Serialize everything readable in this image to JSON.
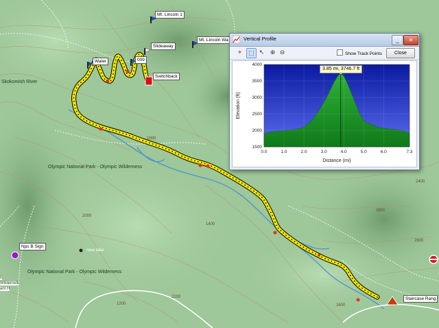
{
  "map": {
    "waypoints": [
      {
        "id": "wp-mt-lincoln-1",
        "label": "Mt. Lincoln 1",
        "icon": "flag-icon"
      },
      {
        "id": "wp-slideaway",
        "label": "Slideaway",
        "icon": "flag-icon"
      },
      {
        "id": "wp-mt-lincoln-wa",
        "label": "Mt. Lincoln Wa",
        "icon": "flag-icon"
      },
      {
        "id": "wp-water",
        "label": "Water",
        "icon": "flag-icon"
      },
      {
        "id": "wp-009",
        "label": "009",
        "icon": "flag-icon"
      },
      {
        "id": "wp-switchback",
        "label": "Switchback",
        "icon": "flag-icon"
      },
      {
        "id": "wp-nps-b-sign",
        "label": "Nps B Sign",
        "icon": "circle-marker-icon"
      },
      {
        "id": "wp-new-lake",
        "label": "new lake",
        "icon": "circle-marker-icon"
      },
      {
        "id": "wp-staircase-rang",
        "label": "Staircase Rang",
        "icon": "campground-icon"
      }
    ],
    "place_labels": {
      "skokomish_river_nw": "Skokomish River",
      "olympic_wilderness_1": "Olympic National Park - Olympic Wilderness",
      "olympic_wilderness_2": "Olympic National Park - Olympic Wilderness",
      "left_edge_a": "lt",
      "left_edge_b": "Wilderne$",
      "left_edge_c": "ant H"
    },
    "elevation_labels": [
      "1800",
      "2000",
      "2400",
      "2800",
      "2600",
      "2200",
      "1600",
      "1200",
      "1400"
    ],
    "colors": {
      "track": "#f2e600",
      "track_outline": "#000000",
      "terrain": "#9ec79a",
      "river": "#4a8fd0"
    }
  },
  "dialog": {
    "title": "Vertical Profile",
    "show_track_points_label": "Show Track Points",
    "close_label": "Close",
    "tooltip": "3.85 mi, 3746.7 ft",
    "toolbar_icons": [
      "crosshair-icon",
      "select-icon",
      "pointer-icon",
      "zoom-in-icon",
      "zoom-out-icon"
    ]
  },
  "chart_data": {
    "type": "area",
    "title": "",
    "xlabel": "Distance (mi)",
    "ylabel": "Elevation (ft)",
    "xlim": [
      0.0,
      7.3
    ],
    "ylim": [
      1500,
      4000
    ],
    "x_ticks": [
      "0.0",
      "1.0",
      "2.0",
      "3.0",
      "4.0",
      "5.0",
      "6.0",
      "7.3"
    ],
    "y_ticks": [
      "1500",
      "2000",
      "2500",
      "3000",
      "3500",
      "4000"
    ],
    "grid": true,
    "colors": {
      "sky_top": "#0a1aa0",
      "sky_bottom": "#5a6cf0",
      "fill_top": "#2fb03a",
      "fill_bottom": "#0f7a1a"
    },
    "cursor": {
      "x": 3.85,
      "y": 3746.7
    },
    "series": [
      {
        "x": [
          0.0,
          0.3,
          0.6,
          0.9,
          1.2,
          1.5,
          1.8,
          2.1,
          2.4,
          2.7,
          2.9,
          3.1,
          3.3,
          3.5,
          3.7,
          3.85,
          4.0,
          4.2,
          4.4,
          4.6,
          4.8,
          5.0,
          5.3,
          5.6,
          5.9,
          6.2,
          6.5,
          6.8,
          7.1,
          7.3
        ],
        "values": [
          1900,
          1950,
          1980,
          1990,
          2010,
          2020,
          2060,
          2150,
          2300,
          2550,
          2750,
          2950,
          3200,
          3450,
          3650,
          3746.7,
          3650,
          3400,
          3100,
          2800,
          2500,
          2300,
          2200,
          2120,
          2080,
          2050,
          2030,
          2010,
          1960,
          1900
        ]
      }
    ]
  }
}
